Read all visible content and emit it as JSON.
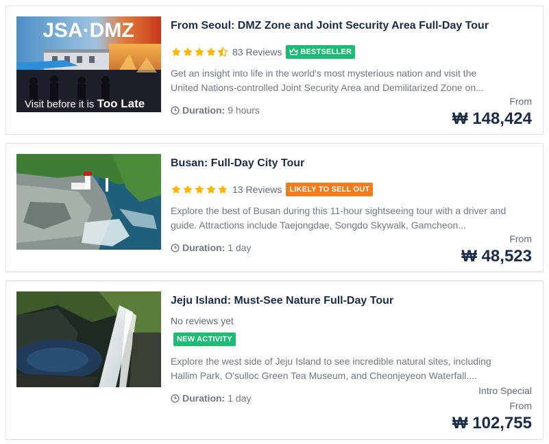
{
  "tours": [
    {
      "title": "From Seoul: DMZ Zone and Joint Security Area Full-Day Tour",
      "rating": 4.5,
      "reviews": "83 Reviews",
      "badge": "BESTSELLER",
      "badge_icon": "crown-icon",
      "badge_color": "#1dbb74",
      "description_lines": [
        "Get an insight into life in the world's most mysterious nation and visit the",
        "United Nations-controlled Joint Security Area and Demilitarized Zone on..."
      ],
      "duration_label": "Duration:",
      "duration_value": "9 hours",
      "price_note": "From",
      "price": "₩ 148,424",
      "image_text_top": "JSA·DMZ",
      "image_text_bottom_1": "Visit before it is",
      "image_text_bottom_2": "Too Late"
    },
    {
      "title": "Busan: Full-Day City Tour",
      "rating": 5,
      "reviews": "13 Reviews",
      "badge": "LIKELY TO SELL OUT",
      "badge_color": "#f27b1c",
      "description_lines": [
        "Explore the best of Busan during this 11-hour sightseeing tour with a driver and",
        "guide. Attractions include Taejongdae, Songdo Skywalk, Gamcheon..."
      ],
      "duration_label": "Duration:",
      "duration_value": "1 day",
      "price_note": "From",
      "price": "₩ 48,523"
    },
    {
      "title": "Jeju Island: Must-See Nature Full-Day Tour",
      "reviews": "No reviews yet",
      "badge": "NEW ACTIVITY",
      "badge_color": "#1dbb74",
      "description_lines": [
        "Explore the west side of Jeju Island to see incredible natural sites, including",
        "Hallim Park, O'sulloc Green Tea Museum, and Cheonjeyeon Waterfall...."
      ],
      "duration_label": "Duration:",
      "duration_value": "1 day",
      "price_note_1": "Intro Special",
      "price_note": "From",
      "price": "₩ 102,755"
    }
  ],
  "colors": {
    "star": "#ffb400",
    "title": "#1a2b49",
    "muted": "#737684"
  }
}
